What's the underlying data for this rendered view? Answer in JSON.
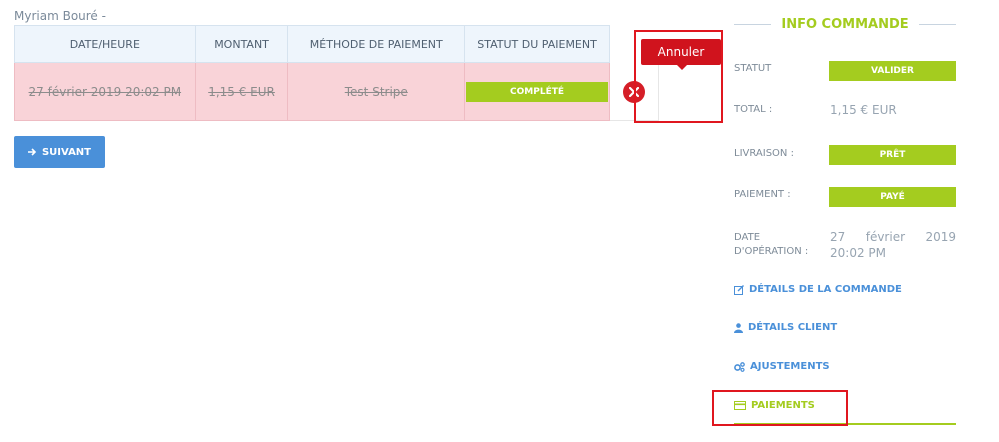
{
  "customer": {
    "name": "Myriam Bouré -"
  },
  "table": {
    "headers": [
      "DATE/HEURE",
      "MONTANT",
      "MÉTHODE DE PAIEMENT",
      "STATUT DU PAIEMENT"
    ],
    "row": {
      "date": "27 février 2019 20:02 PM",
      "amount": "1,15 € EUR",
      "method": "Test Stripe",
      "status": "COMPLÉTÉ"
    },
    "cancel_tooltip": "Annuler"
  },
  "next_button": {
    "label": "SUIVANT",
    "icon": "arrow-right-icon"
  },
  "info": {
    "title": "INFO COMMANDE",
    "status_label": "STATUT",
    "status_value": "VALIDER",
    "total_label": "TOTAL :",
    "total_value": "1,15 € EUR",
    "delivery_label": "LIVRAISON :",
    "delivery_value": "PRÊT",
    "payment_label": "PAIEMENT :",
    "payment_value": "PAYÉ",
    "date_label_line1": "DATE",
    "date_label_line2": "D'OPÉRATION :",
    "date_day": "27",
    "date_month": "février",
    "date_year": "2019",
    "date_time": "20:02 PM"
  },
  "links": [
    {
      "label": "DÉTAILS DE LA COMMANDE",
      "icon": "edit-icon"
    },
    {
      "label": "DÉTAILS CLIENT",
      "icon": "user-icon"
    },
    {
      "label": "AJUSTEMENTS",
      "icon": "cogs-icon"
    },
    {
      "label": "PAIEMENTS",
      "icon": "credit-card-icon"
    }
  ],
  "colors": {
    "accent_green": "#a4cc1f",
    "primary_blue": "#4a90d9",
    "danger_red": "#d0131d",
    "row_cancelled_bg": "#f9d3d8"
  }
}
